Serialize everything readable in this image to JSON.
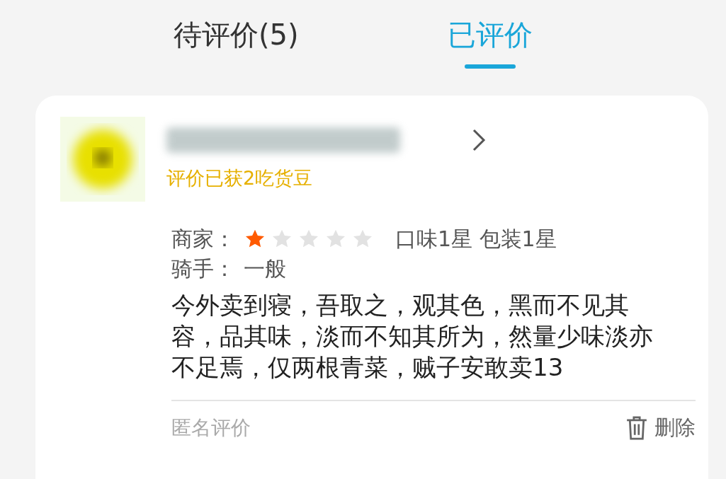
{
  "tabs": [
    {
      "label": "待评价(5)",
      "selected": false
    },
    {
      "label": "已评价",
      "selected": true
    }
  ],
  "review": {
    "reward": "评价已获2吃货豆",
    "merchant_label": "商家：",
    "stars": 1,
    "detail": "口味1星 包装1星",
    "rider_label": "骑手：",
    "rider_rating": "一般",
    "text": "今外卖到寝，吾取之，观其色，黑而不见其容，品其味，淡而不知其所为，然量少味淡亦不足焉，仅两根青菜，贼子安敢卖13",
    "anonymous": "匿名评价",
    "delete": "删除"
  }
}
